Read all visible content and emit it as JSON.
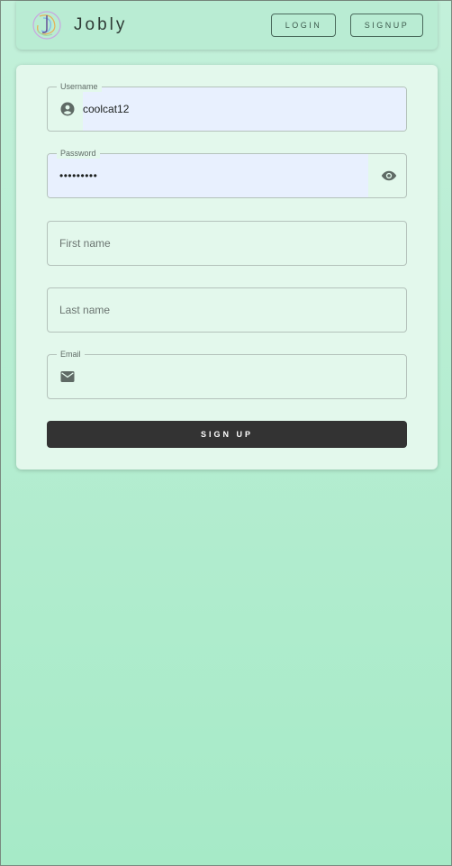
{
  "header": {
    "brand": "Jobly",
    "logo_icon": "jobly-swirl-logo",
    "login_label": "LOGIN",
    "signup_label": "SIGNUP"
  },
  "form": {
    "username": {
      "label": "Username",
      "value": "coolcat12",
      "icon": "account-circle-icon"
    },
    "password": {
      "label": "Password",
      "value": "•••••••••",
      "icon": "eye-icon"
    },
    "first_name": {
      "placeholder": "First name"
    },
    "last_name": {
      "placeholder": "Last name"
    },
    "email": {
      "label": "Email",
      "value": "",
      "icon": "mail-icon"
    },
    "submit_label": "SIGN UP"
  },
  "colors": {
    "background_top": "#c3f0da",
    "background_bottom": "#a6eac7",
    "header_bg": "#b9ecd3",
    "card_bg": "#e3f8ec",
    "autofill_bg": "#e8f0fe",
    "button_bg": "#333333",
    "button_text": "#ffffff"
  }
}
